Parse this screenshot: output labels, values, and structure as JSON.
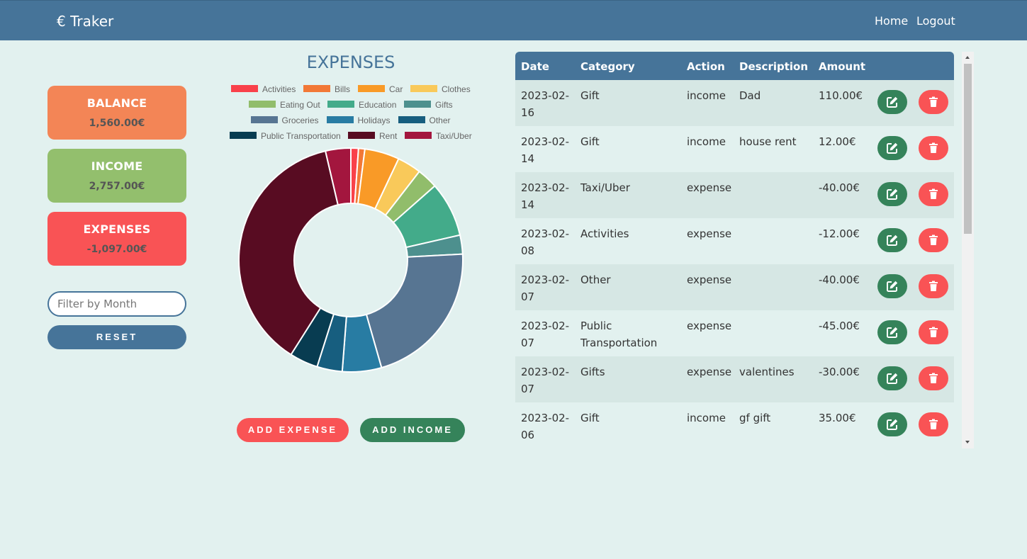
{
  "app": {
    "title": "€ Traker"
  },
  "nav": {
    "home": "Home",
    "logout": "Logout"
  },
  "summary": {
    "balance": {
      "label": "BALANCE",
      "value": "1,560.00€",
      "color": "#f38556"
    },
    "income": {
      "label": "INCOME",
      "value": "2,757.00€",
      "color": "#93bf6d"
    },
    "expenses": {
      "label": "EXPENSES",
      "value": "-1,097.00€",
      "color": "#f95355"
    }
  },
  "filter": {
    "placeholder": "Filter by Month",
    "value": ""
  },
  "buttons": {
    "reset": "RESET",
    "add_expense": "ADD EXPENSE",
    "add_income": "ADD INCOME"
  },
  "colors": {
    "primary": "#467499",
    "edit": "#35835a",
    "delete": "#f95355",
    "background": "#e2f1ef"
  },
  "chart_data": {
    "type": "pie",
    "title": "EXPENSES",
    "legend_position": "top",
    "categories": [
      "Activities",
      "Bills",
      "Car",
      "Clothes",
      "Eating Out",
      "Education",
      "Gifts",
      "Groceries",
      "Holidays",
      "Other",
      "Public Transportation",
      "Rent",
      "Taxi/Uber"
    ],
    "values": [
      12,
      10,
      55,
      38,
      33,
      87,
      30,
      235,
      62,
      40,
      45,
      410,
      40
    ],
    "colors": [
      "#f9414a",
      "#f27836",
      "#f99a27",
      "#f9c95a",
      "#91bd6b",
      "#43ab8a",
      "#4d908e",
      "#577592",
      "#287ca3",
      "#175e7f",
      "#083c51",
      "#580c22",
      "#a3163e"
    ]
  },
  "table": {
    "headers": {
      "date": "Date",
      "category": "Category",
      "action": "Action",
      "description": "Description",
      "amount": "Amount"
    },
    "rows": [
      {
        "date": "2023-02-16",
        "date_line1": "2023-02-",
        "date_line2": "16",
        "category": "Gift",
        "action": "income",
        "description": "Dad",
        "amount": "110.00€"
      },
      {
        "date": "2023-02-14",
        "date_line1": "2023-02-",
        "date_line2": "14",
        "category": "Gift",
        "action": "income",
        "description": "house rent",
        "amount": "12.00€"
      },
      {
        "date": "2023-02-14",
        "date_line1": "2023-02-",
        "date_line2": "14",
        "category": "Taxi/Uber",
        "action": "expense",
        "description": "",
        "amount": "-40.00€"
      },
      {
        "date": "2023-02-08",
        "date_line1": "2023-02-",
        "date_line2": "08",
        "category": "Activities",
        "action": "expense",
        "description": "",
        "amount": "-12.00€"
      },
      {
        "date": "2023-02-07",
        "date_line1": "2023-02-",
        "date_line2": "07",
        "category": "Other",
        "action": "expense",
        "description": "",
        "amount": "-40.00€"
      },
      {
        "date": "2023-02-07",
        "date_line1": "2023-02-",
        "date_line2": "07",
        "category": "Public Transportation",
        "category_line1": "Public",
        "category_line2": "Transportation",
        "action": "expense",
        "description": "",
        "amount": "-45.00€"
      },
      {
        "date": "2023-02-07",
        "date_line1": "2023-02-",
        "date_line2": "07",
        "category": "Gifts",
        "action": "expense",
        "description": "valentines",
        "amount": "-30.00€"
      },
      {
        "date": "2023-02-06",
        "date_line1": "2023-02-",
        "date_line2": "06",
        "category": "Gift",
        "action": "income",
        "description": "gf gift",
        "amount": "35.00€"
      }
    ]
  }
}
